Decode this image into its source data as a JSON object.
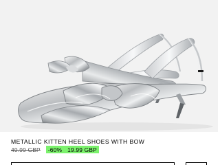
{
  "product": {
    "image_alt": "Silver metallic kitten heel slingback shoes with bow",
    "title": "METALLIC KITTEN HEEL SHOES WITH BOW",
    "original_price": "49.99 GBP",
    "discount": "-60%",
    "sale_price": "19.99 GBP"
  },
  "colors": {
    "background": "#f2f2f2",
    "sale_highlight": "#7cf26d",
    "text": "#000000"
  },
  "icons": [
    "product-photo"
  ]
}
